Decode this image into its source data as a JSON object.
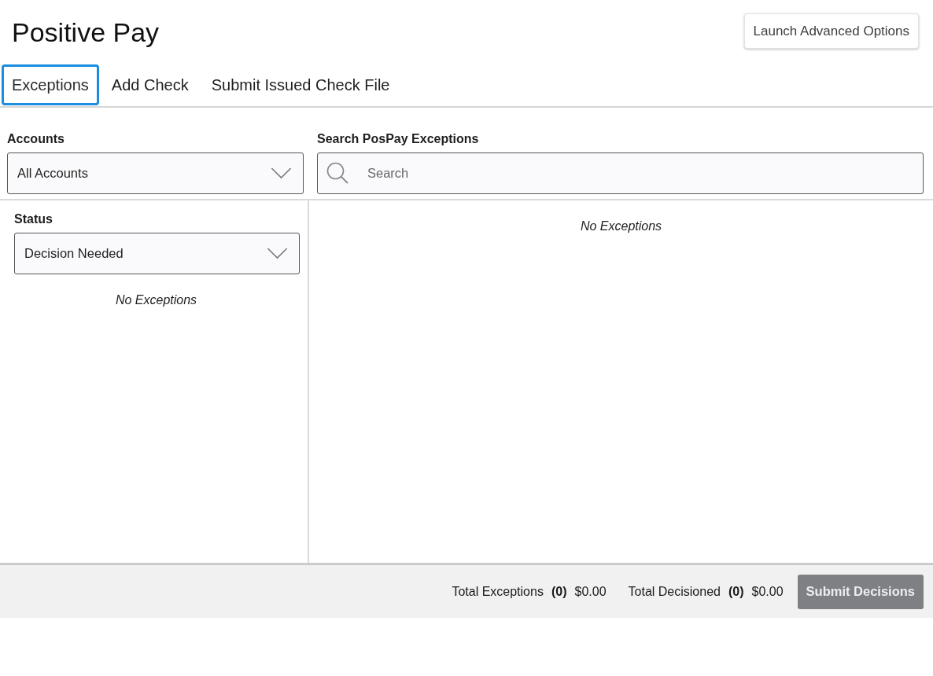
{
  "page": {
    "title": "Positive Pay"
  },
  "header_button": {
    "label": "Launch Advanced Options"
  },
  "tabs": [
    {
      "label": "Exceptions",
      "selected": true
    },
    {
      "label": "Add Check",
      "selected": false
    },
    {
      "label": "Submit Issued Check File",
      "selected": false
    }
  ],
  "filters": {
    "accounts": {
      "label": "Accounts",
      "value": "All Accounts"
    },
    "search": {
      "label": "Search PosPay Exceptions",
      "placeholder": "Search"
    }
  },
  "status_panel": {
    "label": "Status",
    "value": "Decision Needed",
    "empty_message": "No Exceptions"
  },
  "exceptions_panel": {
    "empty_message": "No Exceptions"
  },
  "footer": {
    "totals": [
      {
        "label": "Total Exceptions",
        "count": "(0)",
        "amount": "$0.00"
      },
      {
        "label": "Total Decisioned",
        "count": "(0)",
        "amount": "$0.00"
      }
    ],
    "submit_button": {
      "label": "Submit Decisions",
      "disabled": true
    }
  }
}
